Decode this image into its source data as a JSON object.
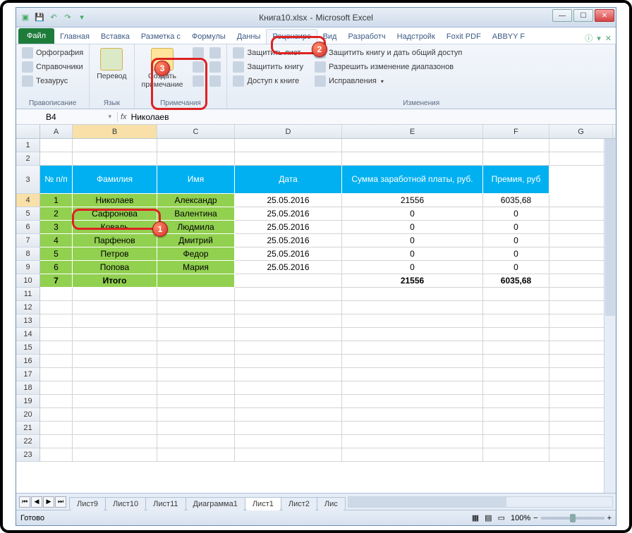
{
  "title": {
    "filename": "Книга10.xlsx",
    "sep": "-",
    "app": "Microsoft Excel"
  },
  "tabs": {
    "file": "Файл",
    "home": "Главная",
    "insert": "Вставка",
    "layout": "Разметка с",
    "formulas": "Формулы",
    "data": "Данны",
    "review": "Рецензирс",
    "view": "Вид",
    "dev": "Разработч",
    "addins": "Надстройк",
    "foxit": "Foxit PDF",
    "abbyy": "ABBYY F"
  },
  "ribbon": {
    "proofing": {
      "label": "Правописание",
      "spelling": "Орфография",
      "research": "Справочники",
      "thesaurus": "Тезаурус"
    },
    "language": {
      "label": "Язык",
      "translate": "Перевод"
    },
    "comments": {
      "label": "Примечания",
      "new": "Создать\nпримечание"
    },
    "changes": {
      "label": "Изменения",
      "protect_sheet": "Защитить лист",
      "protect_book": "Защитить книгу",
      "share": "Доступ к книге",
      "protect_share": "Защитить книгу и дать общий доступ",
      "allow_ranges": "Разрешить изменение диапазонов",
      "track": "Исправления"
    }
  },
  "namebox": "B4",
  "formula": "Николаев",
  "fx": "fx",
  "cols": {
    "A": "A",
    "B": "B",
    "C": "C",
    "D": "D",
    "E": "E",
    "F": "F",
    "G": "G"
  },
  "col_widths": {
    "A": 46,
    "B": 120,
    "C": 110,
    "D": 152,
    "E": 200,
    "F": 94,
    "G": 90
  },
  "headers": {
    "n": "№ п/п",
    "fam": "Фамилия",
    "name": "Имя",
    "date": "Дата",
    "sum": "Сумма заработной платы, руб.",
    "bonus": "Премия, руб"
  },
  "rows": [
    {
      "n": "1",
      "fam": "Николаев",
      "name": "Александр",
      "date": "25.05.2016",
      "sum": "21556",
      "bonus": "6035,68"
    },
    {
      "n": "2",
      "fam": "Сафронова",
      "name": "Валентина",
      "date": "25.05.2016",
      "sum": "0",
      "bonus": "0"
    },
    {
      "n": "3",
      "fam": "Коваль",
      "name": "Людмила",
      "date": "25.05.2016",
      "sum": "0",
      "bonus": "0"
    },
    {
      "n": "4",
      "fam": "Парфенов",
      "name": "Дмитрий",
      "date": "25.05.2016",
      "sum": "0",
      "bonus": "0"
    },
    {
      "n": "5",
      "fam": "Петров",
      "name": "Федор",
      "date": "25.05.2016",
      "sum": "0",
      "bonus": "0"
    },
    {
      "n": "6",
      "fam": "Попова",
      "name": "Мария",
      "date": "25.05.2016",
      "sum": "0",
      "bonus": "0"
    }
  ],
  "total": {
    "n": "7",
    "fam": "Итого",
    "name": "",
    "date": "",
    "sum": "21556",
    "bonus": "6035,68"
  },
  "sheets": [
    "Лист9",
    "Лист10",
    "Лист11",
    "Диаграмма1",
    "Лист1",
    "Лист2",
    "Лис"
  ],
  "active_sheet": 4,
  "status": {
    "ready": "Готово",
    "zoom": "100%"
  },
  "badges": {
    "b1": "1",
    "b2": "2",
    "b3": "3"
  },
  "rownums": [
    "1",
    "2",
    "3",
    "4",
    "5",
    "6",
    "7",
    "8",
    "9",
    "10",
    "11",
    "12",
    "13",
    "14",
    "15",
    "16",
    "17",
    "18",
    "19",
    "20",
    "21",
    "22",
    "23"
  ]
}
